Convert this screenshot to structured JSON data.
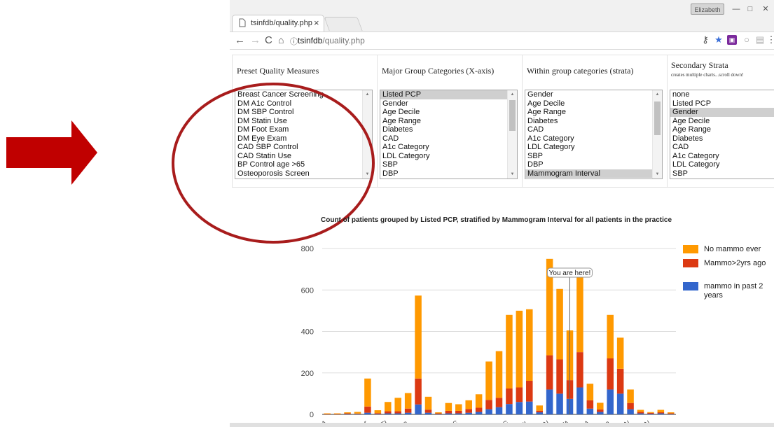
{
  "browser": {
    "tab_title": "tsinfdb/quality.php",
    "tab_close": "×",
    "user_badge": "Elizabeth",
    "address": {
      "host": "tsinfdb",
      "path": "/quality.php"
    },
    "window_buttons": [
      "—",
      "□",
      "✕"
    ]
  },
  "selectors": {
    "preset": {
      "header": "Preset Quality Measures",
      "options": [
        "Breast Cancer Screening",
        "DM A1c Control",
        "DM SBP Control",
        "DM Statin Use",
        "DM Foot Exam",
        "DM Eye Exam",
        "CAD SBP Control",
        "CAD Statin Use",
        "BP Control age >65",
        "Osteoporosis Screen"
      ],
      "selected": []
    },
    "major": {
      "header": "Major Group Categories (X-axis)",
      "options": [
        "Listed PCP",
        "Gender",
        "Age Decile",
        "Age Range",
        "Diabetes",
        "CAD",
        "A1c Category",
        "LDL Category",
        "SBP",
        "DBP"
      ],
      "selected": [
        0
      ]
    },
    "within": {
      "header": "Within group categories (strata)",
      "options": [
        "Gender",
        "Age Decile",
        "Age Range",
        "Diabetes",
        "CAD",
        "A1c Category",
        "LDL Category",
        "SBP",
        "DBP",
        "Mammogram Interval"
      ],
      "selected": [
        9
      ]
    },
    "secondary": {
      "header": "Secondary Strata",
      "subtitle": "creates multiple charts...scroll down!",
      "options": [
        "none",
        "Listed PCP",
        "Gender",
        "Age Decile",
        "Age Range",
        "Diabetes",
        "CAD",
        "A1c Category",
        "LDL Category",
        "SBP"
      ],
      "selected": [
        2
      ]
    }
  },
  "chart_data": {
    "type": "bar",
    "stacked": true,
    "title": "Count of patients grouped by Listed PCP, stratified by Mammogram Interval for all patients in the practice",
    "ylim": [
      0,
      800
    ],
    "yticks": [
      0,
      200,
      400,
      600,
      800
    ],
    "grid": true,
    "legend_position": "right",
    "x_tick_labels": [
      "...A",
      "...G...",
      "...r",
      "...LEI",
      "...a",
      "...l...",
      "...DIS",
      "...",
      "...G",
      "...UL",
      "...AN",
      "...ETA",
      "...INA",
      "...a",
      "...AN",
      "...AN"
    ],
    "annotation": {
      "text": "You are here!",
      "bar_index": 24
    },
    "series": [
      {
        "name": "mammo in past 2 years",
        "color": "#3366cc",
        "values": [
          0,
          0,
          2,
          2,
          8,
          2,
          5,
          5,
          8,
          48,
          8,
          2,
          5,
          5,
          8,
          12,
          25,
          35,
          50,
          60,
          62,
          10,
          120,
          100,
          75,
          130,
          28,
          12,
          120,
          100,
          25,
          5,
          3,
          5,
          2
        ]
      },
      {
        "name": "Mammo>2yrs ago",
        "color": "#dc3912",
        "values": [
          2,
          2,
          3,
          2,
          30,
          4,
          10,
          10,
          20,
          125,
          15,
          3,
          12,
          12,
          18,
          20,
          45,
          45,
          75,
          70,
          100,
          8,
          165,
          165,
          90,
          170,
          40,
          12,
          150,
          120,
          30,
          7,
          4,
          5,
          3
        ]
      },
      {
        "name": "No mammo ever",
        "color": "#ff9900",
        "values": [
          3,
          3,
          5,
          8,
          135,
          14,
          45,
          65,
          75,
          400,
          62,
          5,
          38,
          32,
          42,
          65,
          185,
          225,
          355,
          370,
          345,
          25,
          465,
          340,
          240,
          380,
          80,
          32,
          210,
          150,
          65,
          10,
          4,
          12,
          5
        ]
      }
    ]
  }
}
